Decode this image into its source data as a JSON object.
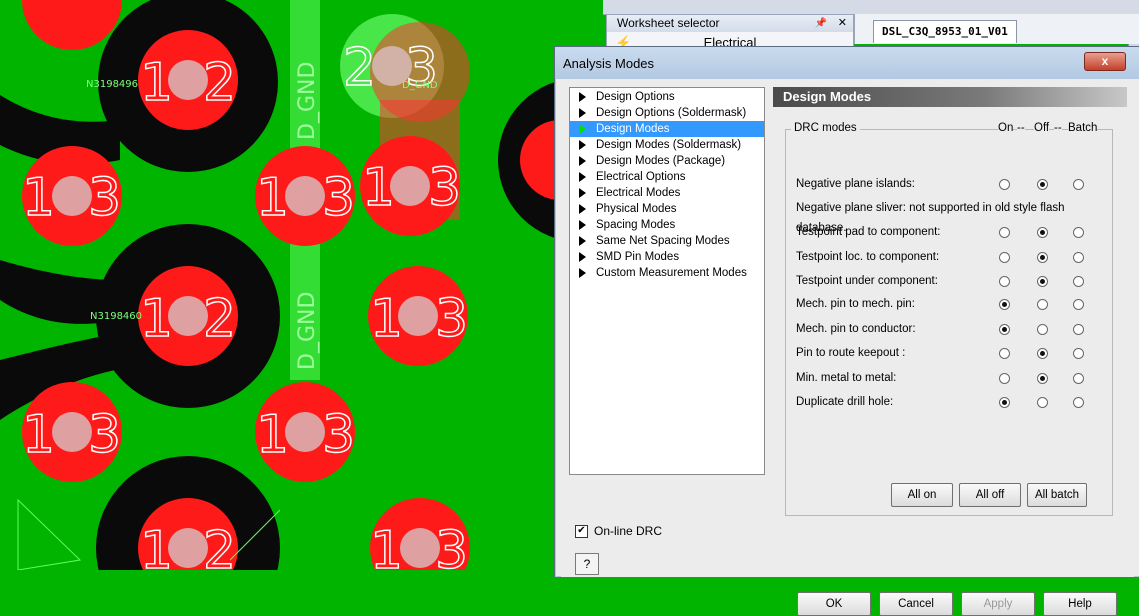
{
  "pcb": {
    "net_labels": [
      "N3198496",
      "N3198460",
      "D_GND",
      "D_GND"
    ],
    "pad_numbers": [
      "1",
      "2",
      "3"
    ]
  },
  "background_app": {
    "worksheet_selector": {
      "title": "Worksheet selector",
      "pin_icon": "pin-icon",
      "close_icon": "close-icon",
      "item": "Electrical"
    },
    "document_tab": "DSL_C3Q_8953_01_V01"
  },
  "dialog": {
    "title": "Analysis Modes",
    "close_label": "x",
    "tree": [
      {
        "label": "Design Options",
        "selected": false
      },
      {
        "label": "Design Options (Soldermask)",
        "selected": false
      },
      {
        "label": "Design Modes",
        "selected": true
      },
      {
        "label": "Design Modes (Soldermask)",
        "selected": false
      },
      {
        "label": "Design Modes (Package)",
        "selected": false
      },
      {
        "label": "Electrical Options",
        "selected": false
      },
      {
        "label": "Electrical Modes",
        "selected": false
      },
      {
        "label": "Physical Modes",
        "selected": false
      },
      {
        "label": "Spacing Modes",
        "selected": false
      },
      {
        "label": "Same Net Spacing Modes",
        "selected": false
      },
      {
        "label": "SMD Pin Modes",
        "selected": false
      },
      {
        "label": "Custom Measurement Modes",
        "selected": false
      }
    ],
    "section_title": "Design Modes",
    "group_label": "DRC modes",
    "col_on": "On",
    "col_sep1": "--",
    "col_off": "Off",
    "col_sep2": "--",
    "col_batch": "Batch",
    "rows": [
      {
        "label": "Negative plane islands:",
        "value": "off"
      },
      {
        "label": "Negative plane sliver: not supported in old style flash database.",
        "value": null
      },
      {
        "label": "Testpoint pad to component:",
        "value": "off"
      },
      {
        "label": "Testpoint loc. to component:",
        "value": "off"
      },
      {
        "label": "Testpoint under component:",
        "value": "off"
      },
      {
        "label": "Mech. pin to mech. pin:",
        "value": "on"
      },
      {
        "label": "Mech. pin to conductor:",
        "value": "on"
      },
      {
        "label": "Pin to route keepout :",
        "value": "off"
      },
      {
        "label": "Min. metal to metal:",
        "value": "off"
      },
      {
        "label": "Duplicate drill hole:",
        "value": "on"
      }
    ],
    "all_on": "All on",
    "all_off": "All off",
    "all_batch": "All batch",
    "online_drc_label": "On-line DRC",
    "online_drc_checked": true,
    "help_label": "?",
    "ok_label": "OK",
    "cancel_label": "Cancel",
    "apply_label": "Apply",
    "help_button_label": "Help"
  }
}
